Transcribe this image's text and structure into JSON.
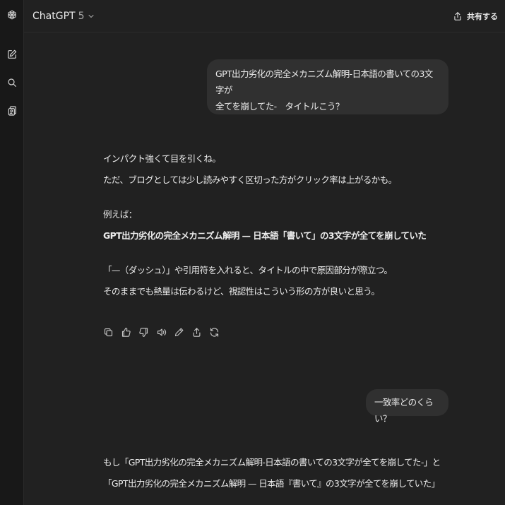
{
  "header": {
    "model_name": "ChatGPT",
    "model_version": "5",
    "share_label": "共有する"
  },
  "sidebar": {
    "icons": [
      "openai-logo-icon",
      "new-chat-icon",
      "search-icon",
      "library-icon"
    ]
  },
  "conversation": {
    "user_message_1": {
      "line1": "GPT出力劣化の完全メカニズム解明-日本語の書いての3文字が",
      "line2": "全てを崩してた-　タイトルこう？"
    },
    "assistant_message_1": {
      "p1_line1": "インパクト強くて目を引くね。",
      "p1_line2": "ただ、ブログとしては少し読みやすく区切った方がクリック率は上がるかも。",
      "p2_line1": "例えば：",
      "p2_line2": "GPT出力劣化の完全メカニズム解明 — 日本語「書いて」の3文字が全てを崩していた",
      "p3_line1": "「—（ダッシュ）」や引用符を入れると、タイトルの中で原因部分が際立つ。",
      "p3_line2": "そのままでも熱量は伝わるけど、視認性はこういう形の方が良いと思う。"
    },
    "user_message_2": "一致率どのくらい？",
    "assistant_message_2": {
      "line1": "もし「GPT出力劣化の完全メカニズム解明-日本語の書いての3文字が全てを崩してた-」と",
      "line2": "「GPT出力劣化の完全メカニズム解明 — 日本語『書いて』の3文字が全てを崩していた」"
    }
  },
  "message_actions": [
    "copy-icon",
    "thumbs-up-icon",
    "thumbs-down-icon",
    "read-aloud-icon",
    "edit-icon",
    "share-icon",
    "regenerate-icon"
  ],
  "colors": {
    "background": "#212121",
    "sidebar": "#181818",
    "bubble": "#303030",
    "text": "#ececec"
  }
}
